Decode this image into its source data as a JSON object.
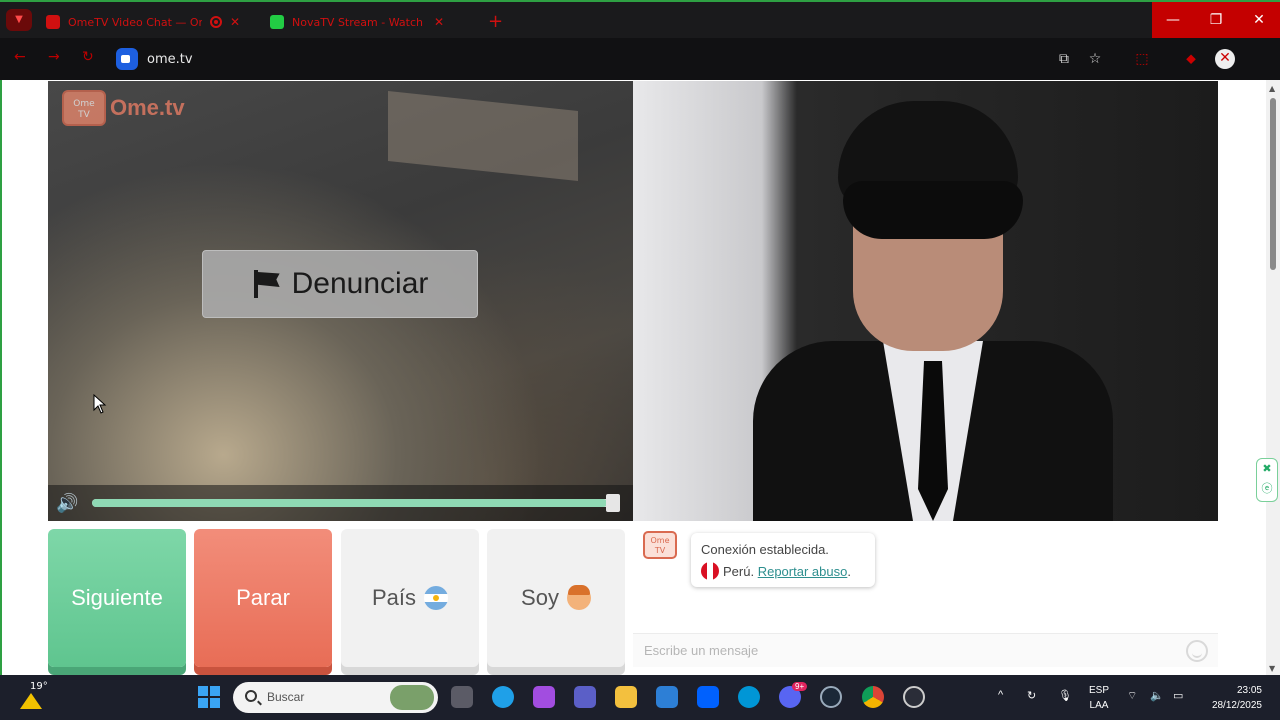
{
  "browser": {
    "tabs": [
      {
        "title": "OmeTV Video Chat — Ome",
        "favicon_color": "#d01010",
        "recording": true
      },
      {
        "title": "NovaTV Stream - Watch Live",
        "favicon_color": "#22cc44"
      }
    ],
    "new_tab": "+",
    "url": "ome.tv",
    "window_controls": {
      "minimize": "—",
      "restore": "❐",
      "close": "✕"
    }
  },
  "logo": {
    "badge_line1": "Ome",
    "badge_line2": "TV",
    "brand": "Ome.tv"
  },
  "report_button": {
    "label": "Denunciar"
  },
  "volume": {
    "level": 0.98
  },
  "controls": {
    "next": "Siguiente",
    "stop": "Parar",
    "country": "País",
    "gender": "Soy"
  },
  "chat": {
    "icon_line1": "Ome",
    "icon_line2": "TV",
    "connection": "Conexión establecida.",
    "country": "Perú.",
    "report_link": "Reportar abuso",
    "report_suffix": ".",
    "input_placeholder": "Escribe un mensaje"
  },
  "taskbar": {
    "temperature": "19°",
    "search_placeholder": "Buscar",
    "lang_line1": "ESP",
    "lang_line2": "LAA",
    "time": "23:05",
    "date": "28/12/2025",
    "discord_badge": "9+"
  },
  "colors": {
    "accent_green": "#5fc58f",
    "accent_orange": "#e86d56",
    "link_teal": "#2e8f8f",
    "chrome_red": "#c40000"
  }
}
